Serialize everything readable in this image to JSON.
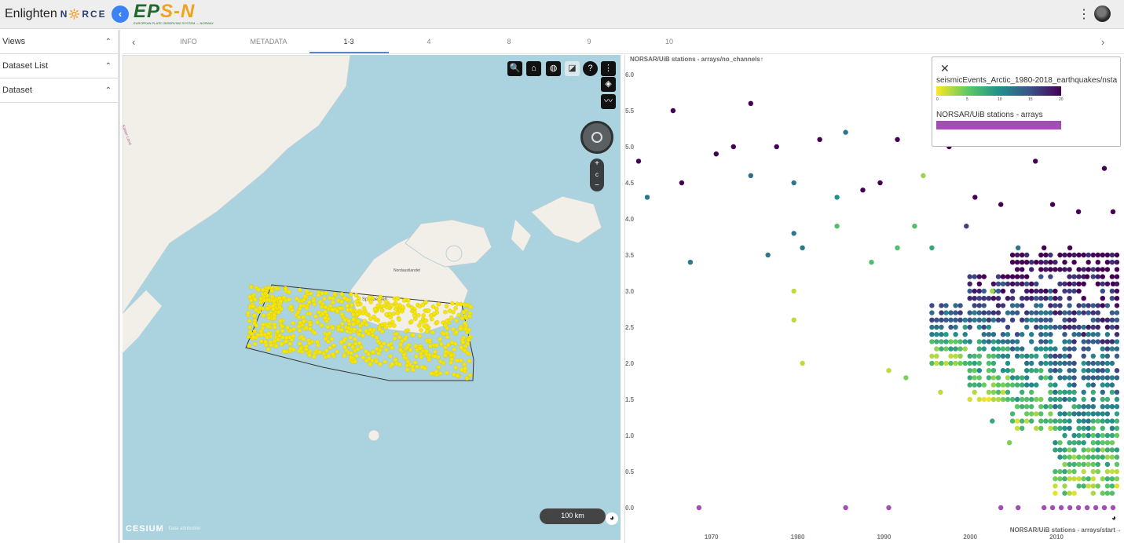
{
  "app": {
    "brand": "Enlighten",
    "partner": "N🔆RCE",
    "collapse_icon": "‹",
    "logo_text_a": "EP",
    "logo_text_b": "S-N",
    "logo_sub": "EUROPEAN PLATE OBSERVING SYSTEM — NORWAY",
    "menu_icon": "⋮"
  },
  "sidebar": {
    "items": [
      {
        "label": "Views",
        "chevron": "⌃"
      },
      {
        "label": "Dataset List",
        "chevron": "⌃"
      },
      {
        "label": "Dataset",
        "chevron": "⌃"
      }
    ]
  },
  "tabs": {
    "prev": "‹",
    "next": "›",
    "items": [
      "INFO",
      "METADATA",
      "1-3",
      "4",
      "8",
      "9",
      "10"
    ],
    "active": "1-3"
  },
  "map": {
    "tools": [
      "🔍",
      "⌂",
      "◍",
      "◪",
      "?",
      "⋮"
    ],
    "layers_icon": "◈",
    "chart_icon": "〰",
    "zoom_in": "+",
    "zoom_out": "−",
    "zoom_reset": "c",
    "scale_label": "100 km",
    "attribution": "CESIUM",
    "attribution_note": "Data attribution",
    "place_labels": [
      "Spitsbergen",
      "Nordaustlandet",
      "Kaiser Land"
    ],
    "event_color": "#f5e50f",
    "water_color": "#abd3df",
    "land_color": "#f2efe9"
  },
  "chart_data": {
    "type": "scatter",
    "title": "NORSAR/UiB stations - arrays/no_channels↑",
    "xlabel": "NORSAR/UiB stations - arrays/start→",
    "x_ticks": [
      "1970",
      "1980",
      "1990",
      "2000",
      "2010"
    ],
    "y_ticks": [
      "0.0",
      "0.5",
      "1.0",
      "1.5",
      "2.0",
      "2.5",
      "3.0",
      "3.5",
      "4.0",
      "4.5",
      "5.0",
      "5.5",
      "6.0"
    ],
    "xlim": [
      1961,
      2018
    ],
    "ylim": [
      0,
      6
    ],
    "colorbar": {
      "name": "seismicEvents_Arctic_1980-2018_earthquakes/nsta",
      "range": [
        0,
        20
      ],
      "ticks": [
        "0",
        "5",
        "10",
        "15",
        "20"
      ]
    },
    "series": [
      {
        "name": "NORSAR/UiB stations - arrays",
        "color": "#a24fb4",
        "points": [
          [
            1969,
            0
          ],
          [
            1986,
            0
          ],
          [
            1991,
            0
          ],
          [
            2004,
            0
          ],
          [
            2006,
            0
          ],
          [
            2009,
            0
          ],
          [
            2010,
            0
          ],
          [
            2011,
            0
          ],
          [
            2012,
            0
          ],
          [
            2013,
            0
          ],
          [
            2014,
            0
          ],
          [
            2015,
            0
          ],
          [
            2016,
            0
          ],
          [
            2017,
            0
          ]
        ]
      }
    ],
    "earthquake_sample": [
      [
        1962,
        4.8,
        20
      ],
      [
        1963,
        4.3,
        12
      ],
      [
        1966,
        5.5,
        20
      ],
      [
        1967,
        4.5,
        20
      ],
      [
        1971,
        4.9,
        20
      ],
      [
        1973,
        5.0,
        20
      ],
      [
        1975,
        5.6,
        20
      ],
      [
        1975,
        4.6,
        13
      ],
      [
        1978,
        5.0,
        20
      ],
      [
        1980,
        3.8,
        12
      ],
      [
        1980,
        4.5,
        12
      ],
      [
        1983,
        5.1,
        20
      ],
      [
        1985,
        4.3,
        10
      ],
      [
        1986,
        5.2,
        12
      ],
      [
        1988,
        4.4,
        20
      ],
      [
        1990,
        4.5,
        20
      ],
      [
        1992,
        5.1,
        20
      ],
      [
        1995,
        4.6,
        3
      ],
      [
        1996,
        3.6,
        8
      ],
      [
        1998,
        5.0,
        20
      ],
      [
        2000,
        3.9,
        16
      ],
      [
        2001,
        4.3,
        20
      ],
      [
        2003,
        3.0,
        3
      ],
      [
        2004,
        4.2,
        20
      ],
      [
        2006,
        3.6,
        12
      ],
      [
        2008,
        4.8,
        20
      ],
      [
        2009,
        3.6,
        20
      ],
      [
        2010,
        4.2,
        20
      ],
      [
        2012,
        3.6,
        20
      ],
      [
        2013,
        4.1,
        20
      ],
      [
        2014,
        3.2,
        20
      ],
      [
        2016,
        4.7,
        20
      ],
      [
        2017,
        4.1,
        20
      ],
      [
        2017,
        3.1,
        20
      ],
      [
        1981,
        2.0,
        2
      ],
      [
        1980,
        2.6,
        2
      ],
      [
        1980,
        3.0,
        2
      ],
      [
        1991,
        1.9,
        2
      ],
      [
        1993,
        1.8,
        4
      ],
      [
        1997,
        1.6,
        2
      ],
      [
        2003,
        1.2,
        8
      ],
      [
        2005,
        0.9,
        4
      ],
      [
        1968,
        3.4,
        12
      ],
      [
        1977,
        3.5,
        12
      ],
      [
        1981,
        3.6,
        12
      ],
      [
        1985,
        3.9,
        6
      ],
      [
        1989,
        3.4,
        6
      ],
      [
        1992,
        3.6,
        6
      ],
      [
        1994,
        3.9,
        6
      ]
    ]
  }
}
